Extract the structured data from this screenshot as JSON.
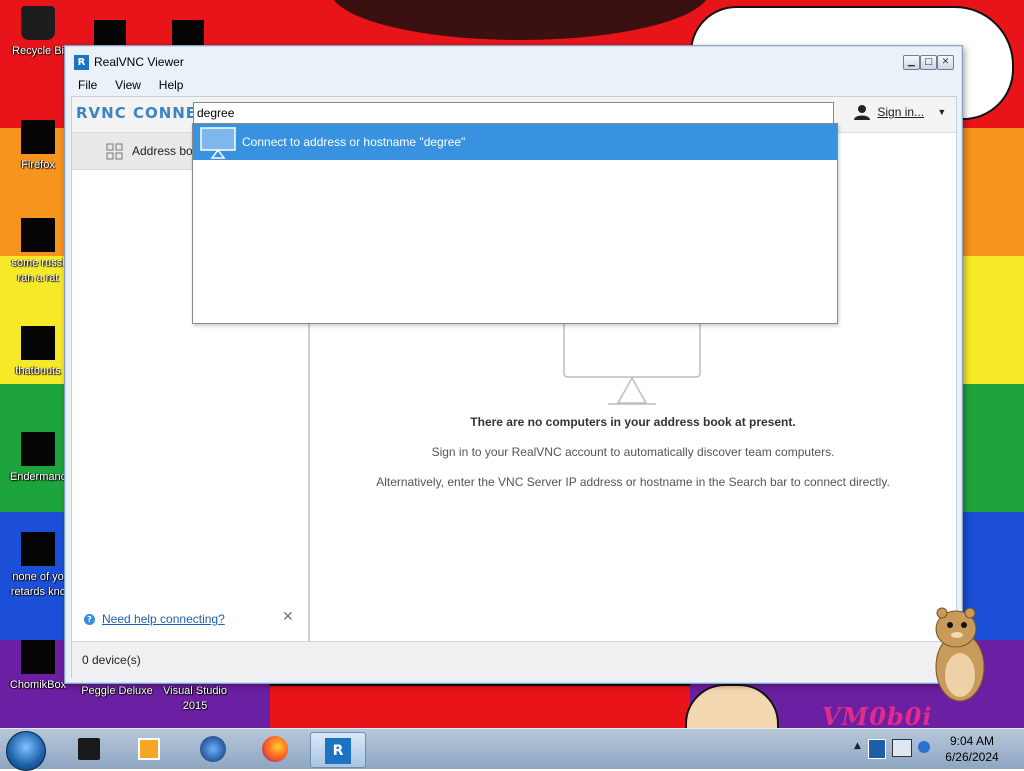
{
  "desktop": {
    "icons": [
      {
        "label": "Recycle Bi"
      },
      {
        "label": "Firefox"
      },
      {
        "label": "some russi\nran a rat"
      },
      {
        "label": "thatbuuts"
      },
      {
        "label": "Endermanc"
      },
      {
        "label": "none of yo\nretards knc"
      },
      {
        "label": "ChomikBox"
      },
      {
        "label": "Peggle Deluxe"
      },
      {
        "label": "Visual Studio\n2015"
      }
    ],
    "watermark": "VM0b0i"
  },
  "window": {
    "title": "RealVNC Viewer",
    "menu": [
      "File",
      "View",
      "Help"
    ],
    "logo": "RVNC CONNECT",
    "search": {
      "value": "degree",
      "placeholder": ""
    },
    "signin_label": "Sign in...",
    "sidebar": {
      "address_book_label": "Address boo",
      "help_link": "Need help connecting?"
    },
    "dropdown": {
      "item_label": "Connect to address or hostname \"degree\""
    },
    "main": {
      "empty_title": "There are no computers in your address book at present.",
      "empty_line1": "Sign in to your RealVNC account to automatically discover team computers.",
      "empty_line2": "Alternatively, enter the VNC Server IP address or hostname in the Search bar to connect directly."
    },
    "status": "0 device(s)"
  },
  "taskbar": {
    "items": [
      "terminal-icon",
      "media-player-icon",
      "globe-icon",
      "firefox-icon",
      "realvnc-icon"
    ],
    "time": "9:04 AM",
    "date": "6/26/2024"
  },
  "colors": {
    "accent": "#3892e0",
    "logo": "#3c84c4",
    "link": "#1a5fb4"
  }
}
